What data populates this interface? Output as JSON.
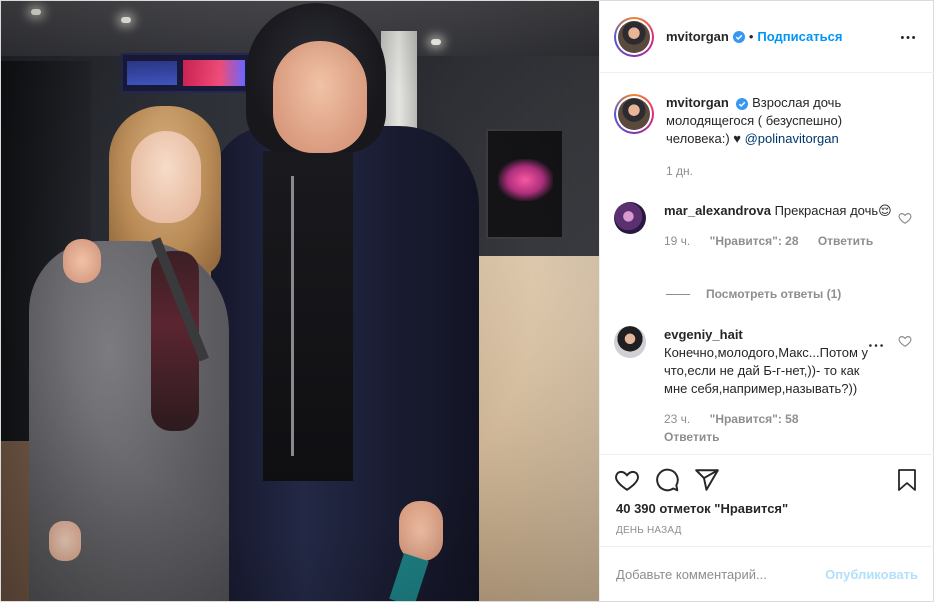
{
  "header": {
    "username": "mvitorgan",
    "separator": "•",
    "follow_label": "Подписаться"
  },
  "caption": {
    "username": "mvitorgan",
    "text": " Взрослая дочь молодящегося ( безуспешно) человека:) ♥ ",
    "mention": "@polinavitorgan",
    "time": "1 дн."
  },
  "comments": [
    {
      "username": "mar_alexandrova",
      "text": " Прекрасная дочь😌",
      "time": "19 ч.",
      "likes": "\"Нравится\": 28",
      "reply": "Ответить",
      "view_replies": "Посмотреть ответы (1)"
    },
    {
      "username": "evgeniy_hait",
      "text": "Конечно,молодого,Макс...Потом у что,если не дай Б-г-нет,))- то как мне себя,например,называть?))",
      "time": "23 ч.",
      "likes": "\"Нравится\": 58",
      "reply": "Ответить"
    }
  ],
  "actions": {
    "likes": "40 390 отметок \"Нравится\"",
    "time": "ДЕНЬ НАЗАД"
  },
  "add_comment": {
    "placeholder": "Добавьте комментарий...",
    "publish_label": "Опубликовать"
  },
  "colors": {
    "accent": "#0095f6",
    "verified": "#3897f0",
    "muted": "#8e8e8e",
    "publish_disabled": "#b2dffc"
  },
  "icons": [
    "verified-badge-icon",
    "more-options-icon",
    "heart-icon",
    "comment-icon",
    "share-icon",
    "bookmark-icon"
  ]
}
